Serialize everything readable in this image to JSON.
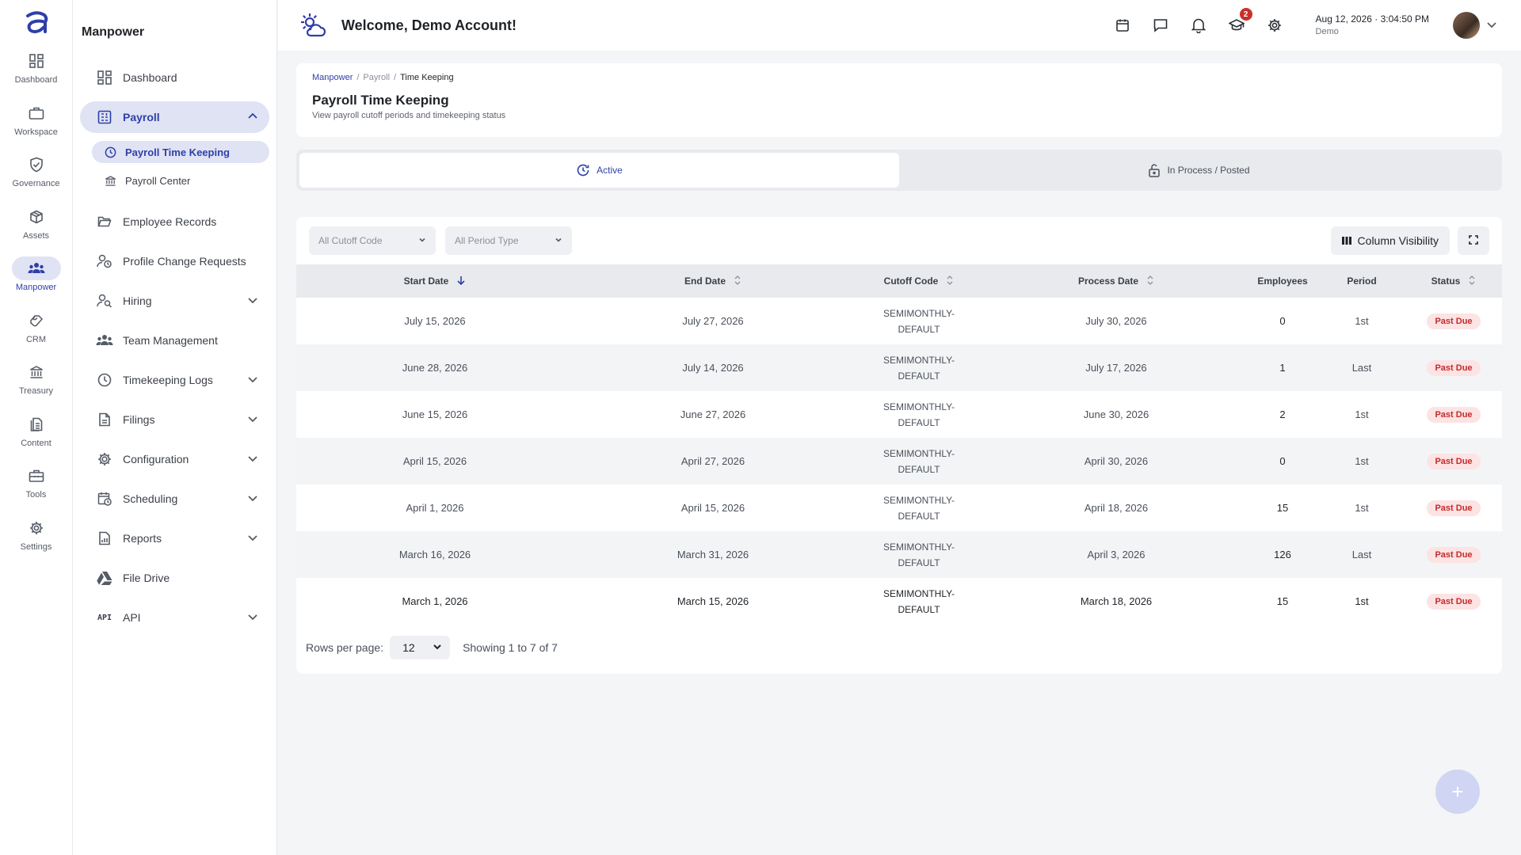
{
  "app": {
    "logo_icon": "brand-a-icon",
    "accent": "#2f3fa8",
    "status_color": "#c42b2b"
  },
  "rail": [
    {
      "label": "Dashboard",
      "icon": "dashboard-icon"
    },
    {
      "label": "Workspace",
      "icon": "briefcase-icon"
    },
    {
      "label": "Governance",
      "icon": "shield-check-icon"
    },
    {
      "label": "Assets",
      "icon": "box-icon"
    },
    {
      "label": "Manpower",
      "icon": "people-icon",
      "active": true
    },
    {
      "label": "CRM",
      "icon": "handshake-icon"
    },
    {
      "label": "Treasury",
      "icon": "bank-icon"
    },
    {
      "label": "Content",
      "icon": "document-icon"
    },
    {
      "label": "Tools",
      "icon": "toolbox-icon"
    },
    {
      "label": "Settings",
      "icon": "gear-icon"
    }
  ],
  "nav": {
    "title": "Manpower",
    "items": [
      {
        "label": "Dashboard"
      },
      {
        "label": "Payroll"
      },
      {
        "label": "Employee Records"
      },
      {
        "label": "Profile Change Requests"
      },
      {
        "label": "Hiring"
      },
      {
        "label": "Team Management"
      },
      {
        "label": "Timekeeping Logs"
      },
      {
        "label": "Filings"
      },
      {
        "label": "Configuration"
      },
      {
        "label": "Scheduling"
      },
      {
        "label": "Reports"
      },
      {
        "label": "File Drive"
      },
      {
        "label": "API"
      }
    ],
    "payroll_sub": [
      {
        "label": "Payroll Time Keeping"
      },
      {
        "label": "Payroll Center"
      }
    ]
  },
  "header": {
    "welcome": "Welcome, Demo Account!",
    "notification_badge": "2",
    "date": "Aug 12, 2026",
    "time": "3:04:50 PM",
    "user": "Demo"
  },
  "breadcrumb": [
    "Manpower",
    "Payroll",
    "Time Keeping"
  ],
  "page": {
    "title": "Payroll Time Keeping",
    "subtitle": "View payroll cutoff periods and timekeeping status"
  },
  "tabs": [
    {
      "label": "Active"
    },
    {
      "label": "In Process / Posted"
    }
  ],
  "filters": {
    "cutoff_code": "All Cutoff Code",
    "period_type": "All Period Type",
    "column_visibility": "Column Visibility"
  },
  "table": {
    "columns": [
      "Start Date",
      "End Date",
      "Cutoff Code",
      "Process Date",
      "Employees",
      "Period",
      "Status"
    ],
    "rows": [
      {
        "start": "July 15, 2026",
        "end": "July 27, 2026",
        "code1": "SEMIMONTHLY-",
        "code2": "DEFAULT",
        "process": "July 30, 2026",
        "employees": "0",
        "period": "1st",
        "status": "Past Due"
      },
      {
        "start": "June 28, 2026",
        "end": "July 14, 2026",
        "code1": "SEMIMONTHLY-",
        "code2": "DEFAULT",
        "process": "July 17, 2026",
        "employees": "1",
        "period": "Last",
        "status": "Past Due"
      },
      {
        "start": "June 15, 2026",
        "end": "June 27, 2026",
        "code1": "SEMIMONTHLY-",
        "code2": "DEFAULT",
        "process": "June 30, 2026",
        "employees": "2",
        "period": "1st",
        "status": "Past Due"
      },
      {
        "start": "April 15, 2026",
        "end": "April 27, 2026",
        "code1": "SEMIMONTHLY-",
        "code2": "DEFAULT",
        "process": "April 30, 2026",
        "employees": "0",
        "period": "1st",
        "status": "Past Due"
      },
      {
        "start": "April 1, 2026",
        "end": "April 15, 2026",
        "code1": "SEMIMONTHLY-",
        "code2": "DEFAULT",
        "process": "April 18, 2026",
        "employees": "15",
        "period": "1st",
        "status": "Past Due"
      },
      {
        "start": "March 16, 2026",
        "end": "March 31, 2026",
        "code1": "SEMIMONTHLY-",
        "code2": "DEFAULT",
        "process": "April 3, 2026",
        "employees": "126",
        "period": "Last",
        "status": "Past Due"
      },
      {
        "start": "March 1, 2026",
        "end": "March 15, 2026",
        "code1": "SEMIMONTHLY-",
        "code2": "DEFAULT",
        "process": "March 18, 2026",
        "employees": "15",
        "period": "1st",
        "status": "Past Due"
      }
    ]
  },
  "pager": {
    "rows_label": "Rows per page:",
    "rows_value": "12",
    "showing": "Showing 1 to 7 of 7"
  },
  "fab": {
    "label": "+"
  }
}
